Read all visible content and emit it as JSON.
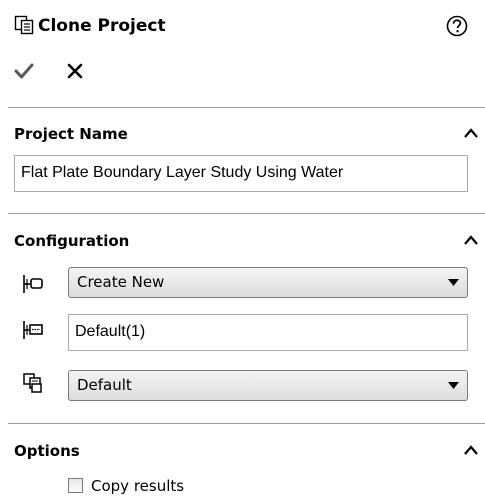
{
  "header": {
    "title": "Clone Project",
    "title_icon": "clone-project-icon",
    "help_icon": "help-icon",
    "ok_icon": "checkmark-icon",
    "cancel_icon": "close-icon"
  },
  "project_name": {
    "title": "Project Name",
    "value": "Flat Plate Boundary Layer Study Using Water"
  },
  "configuration": {
    "title": "Configuration",
    "mode_selected": "Create New",
    "new_name_value": "Default(1)",
    "base_selected": "Default",
    "icons": [
      "configuration-mode-icon",
      "configuration-name-icon",
      "base-configuration-icon"
    ]
  },
  "options": {
    "title": "Options",
    "copy_results_label": "Copy results",
    "copy_results_checked": false
  },
  "colors": {
    "background": "#ffffff",
    "divider": "#a0a0a0",
    "control_border": "#7a7a7a",
    "check_color": "#5a5a5a"
  }
}
